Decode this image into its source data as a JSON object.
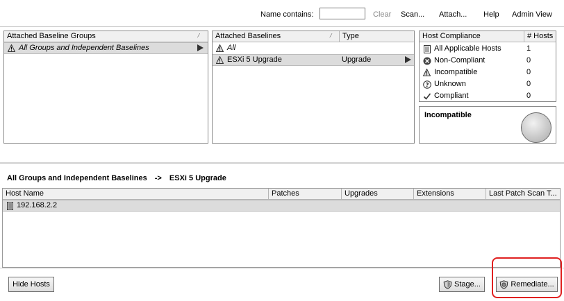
{
  "toolbar": {
    "name_contains_label": "Name contains:",
    "name_contains_value": "",
    "clear_label": "Clear",
    "scan_label": "Scan...",
    "attach_label": "Attach...",
    "help_label": "Help",
    "admin_view_label": "Admin View"
  },
  "baseline_groups": {
    "header": "Attached Baseline Groups",
    "items": [
      {
        "icon": "warning-icon",
        "label": "All Groups and Independent Baselines",
        "selected": true
      }
    ]
  },
  "baselines": {
    "headers": [
      "Attached Baselines",
      "Type"
    ],
    "items": [
      {
        "icon": "warning-icon",
        "name": "All",
        "type": ""
      },
      {
        "icon": "warning-icon",
        "name": "ESXi 5 Upgrade",
        "type": "Upgrade",
        "selected": true
      }
    ]
  },
  "host_compliance": {
    "headers": [
      "Host Compliance",
      "# Hosts"
    ],
    "items": [
      {
        "icon": "document-icon",
        "label": "All Applicable Hosts",
        "count": "1"
      },
      {
        "icon": "error-circle-icon",
        "label": "Non-Compliant",
        "count": "0"
      },
      {
        "icon": "warning-icon",
        "label": "Incompatible",
        "count": "0"
      },
      {
        "icon": "question-icon",
        "label": "Unknown",
        "count": "0"
      },
      {
        "icon": "checkmark-icon",
        "label": "Compliant",
        "count": "0"
      }
    ]
  },
  "status_box": {
    "title": "Incompatible",
    "indicator_color": "#c4c4c4"
  },
  "breadcrumb": {
    "from": "All Groups and Independent Baselines",
    "separator": "->",
    "to": "ESXi 5 Upgrade"
  },
  "hosts_table": {
    "headers": [
      "Host Name",
      "Patches",
      "Upgrades",
      "Extensions",
      "Last Patch Scan T..."
    ],
    "rows": [
      {
        "icon": "host-icon",
        "host_name": "192.168.2.2",
        "patches": "",
        "upgrades": "",
        "extensions": "",
        "last_scan": ""
      }
    ]
  },
  "buttons": {
    "hide_hosts": "Hide Hosts",
    "stage": "Stage...",
    "remediate": "Remediate..."
  },
  "colors": {
    "highlight": "#e02020",
    "selection": "#dcdcdc",
    "header_bg": "#f0f0f0"
  }
}
